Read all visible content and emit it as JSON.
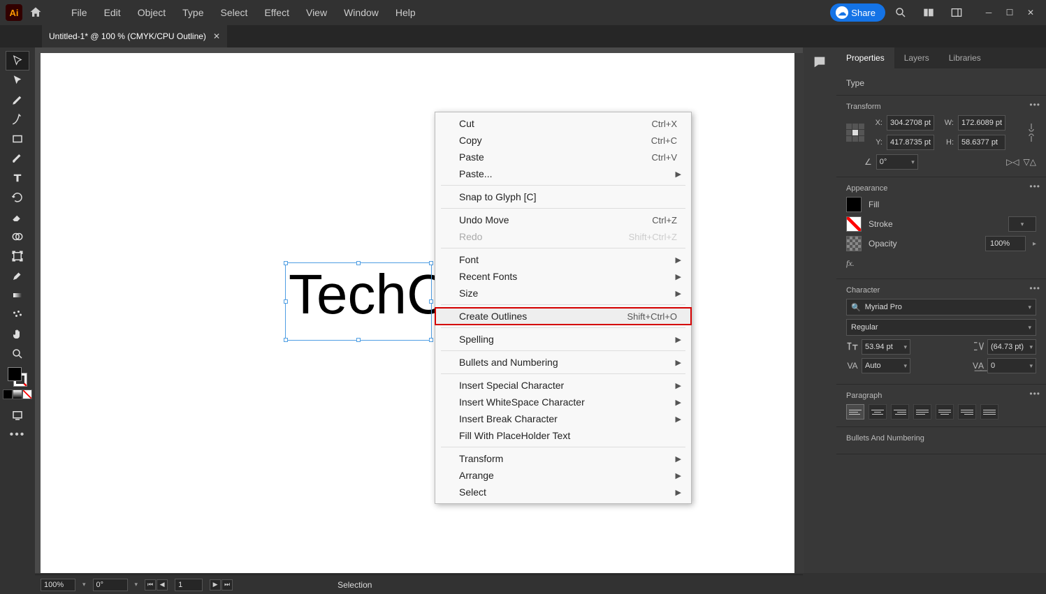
{
  "menu": {
    "items": [
      "File",
      "Edit",
      "Object",
      "Type",
      "Select",
      "Effect",
      "View",
      "Window",
      "Help"
    ]
  },
  "share_label": "Share",
  "tab": {
    "title": "Untitled-1* @ 100 % (CMYK/CPU Outline)"
  },
  "canvas": {
    "text": "TechC"
  },
  "context_menu": {
    "groups": [
      [
        {
          "label": "Cut",
          "shortcut": "Ctrl+X"
        },
        {
          "label": "Copy",
          "shortcut": "Ctrl+C"
        },
        {
          "label": "Paste",
          "shortcut": "Ctrl+V"
        },
        {
          "label": "Paste...",
          "submenu": true
        }
      ],
      [
        {
          "label": "Snap to Glyph [C]"
        }
      ],
      [
        {
          "label": "Undo Move",
          "shortcut": "Ctrl+Z"
        },
        {
          "label": "Redo",
          "shortcut": "Shift+Ctrl+Z",
          "disabled": true
        }
      ],
      [
        {
          "label": "Font",
          "submenu": true
        },
        {
          "label": "Recent Fonts",
          "submenu": true
        },
        {
          "label": "Size",
          "submenu": true
        }
      ],
      [
        {
          "label": "Create Outlines",
          "shortcut": "Shift+Ctrl+O",
          "highlighted": true
        }
      ],
      [
        {
          "label": "Spelling",
          "submenu": true
        }
      ],
      [
        {
          "label": "Bullets and Numbering",
          "submenu": true
        }
      ],
      [
        {
          "label": "Insert Special Character",
          "submenu": true
        },
        {
          "label": "Insert WhiteSpace Character",
          "submenu": true
        },
        {
          "label": "Insert Break Character",
          "submenu": true
        },
        {
          "label": "Fill With PlaceHolder Text"
        }
      ],
      [
        {
          "label": "Transform",
          "submenu": true
        },
        {
          "label": "Arrange",
          "submenu": true
        },
        {
          "label": "Select",
          "submenu": true
        }
      ]
    ]
  },
  "panels": {
    "tabs": [
      "Properties",
      "Layers",
      "Libraries"
    ],
    "type_label": "Type",
    "transform": {
      "title": "Transform",
      "x_label": "X:",
      "x": "304.2708 pt",
      "y_label": "Y:",
      "y": "417.8735 pt",
      "w_label": "W:",
      "w": "172.6089 pt",
      "h_label": "H:",
      "h": "58.6377 pt",
      "angle": "0°"
    },
    "appearance": {
      "title": "Appearance",
      "fill_label": "Fill",
      "stroke_label": "Stroke",
      "opacity_label": "Opacity",
      "opacity_value": "100%",
      "fx_label": "fx."
    },
    "character": {
      "title": "Character",
      "font": "Myriad Pro",
      "style": "Regular",
      "size": "53.94 pt",
      "leading": "(64.73 pt)",
      "kerning": "Auto",
      "tracking": "0"
    },
    "paragraph": {
      "title": "Paragraph"
    },
    "bullets_title": "Bullets And Numbering"
  },
  "status": {
    "zoom": "100%",
    "rotation": "0°",
    "artboard": "1",
    "mode": "Selection"
  }
}
